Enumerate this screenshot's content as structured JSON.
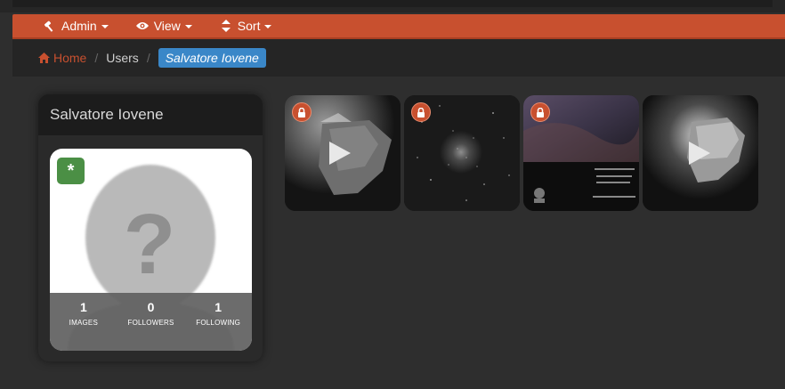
{
  "navbar": {
    "items": [
      {
        "label": "Admin",
        "icon": "gavel-icon"
      },
      {
        "label": "View",
        "icon": "eye-icon"
      },
      {
        "label": "Sort",
        "icon": "sort-icon"
      }
    ]
  },
  "breadcrumb": {
    "home": "Home",
    "users": "Users",
    "current": "Salvatore Iovene"
  },
  "profile": {
    "name": "Salvatore Iovene",
    "badge": "*",
    "stats": [
      {
        "value": "1",
        "label": "IMAGES"
      },
      {
        "value": "0",
        "label": "FOLLOWERS"
      },
      {
        "value": "1",
        "label": "FOLLOWING"
      }
    ]
  },
  "thumbnails": [
    {
      "subject": "comet",
      "locked": true,
      "video": true
    },
    {
      "subject": "star-cluster",
      "locked": true,
      "video": false
    },
    {
      "subject": "telescope-ad",
      "locked": true,
      "video": false
    },
    {
      "subject": "comet",
      "locked": false,
      "video": true
    }
  ],
  "colors": {
    "accent": "#c8502f",
    "active_breadcrumb": "#3a87c8",
    "badge": "#4b8f45"
  }
}
